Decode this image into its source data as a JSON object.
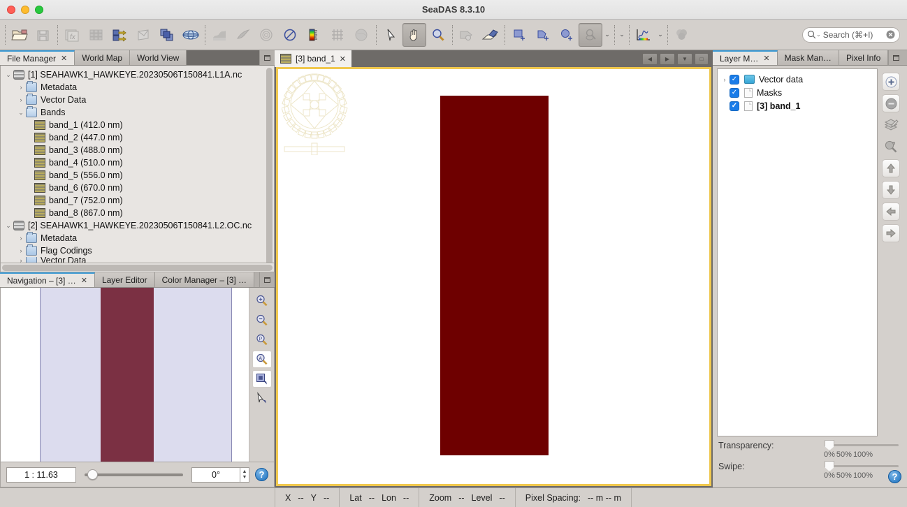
{
  "window": {
    "title": "SeaDAS 8.3.10",
    "controls": [
      "close",
      "minimize",
      "maximize"
    ]
  },
  "toolbar": {
    "groups": [
      {
        "items": [
          {
            "name": "open-product-icon",
            "label": "Open Product",
            "state": "enabled"
          },
          {
            "name": "save-product-icon",
            "label": "Save Product",
            "state": "disabled"
          }
        ]
      },
      {
        "items": [
          {
            "name": "band-maths-icon",
            "label": "Band Maths",
            "state": "disabled"
          },
          {
            "name": "grid-icon",
            "label": "Product Grid",
            "state": "disabled"
          },
          {
            "name": "reproject-icon",
            "label": "Reproject",
            "state": "enabled"
          },
          {
            "name": "subset-icon",
            "label": "Subset",
            "state": "disabled"
          },
          {
            "name": "collocate-icon",
            "label": "Collocation",
            "state": "enabled"
          },
          {
            "name": "globe-mesh-icon",
            "label": "Geo Coding",
            "state": "enabled"
          }
        ]
      },
      {
        "items": [
          {
            "name": "land-mask-icon",
            "label": "Land Water Mask",
            "state": "disabled"
          },
          {
            "name": "ocean-color-icon",
            "label": "Ocean Color",
            "state": "disabled"
          },
          {
            "name": "sst-icon",
            "label": "SST",
            "state": "disabled"
          },
          {
            "name": "no-data-icon",
            "label": "No Data Overlay",
            "state": "enabled"
          },
          {
            "name": "color-bar-icon",
            "label": "Colour Bar",
            "state": "enabled"
          },
          {
            "name": "graticule-icon",
            "label": "Graticule Overlay",
            "state": "disabled"
          },
          {
            "name": "world-map-overlay-icon",
            "label": "World Map Overlay",
            "state": "disabled"
          }
        ]
      },
      {
        "items": [
          {
            "name": "selection-arrow-icon",
            "label": "Selection Tool",
            "state": "enabled"
          },
          {
            "name": "pan-hand-icon",
            "label": "Panning Tool",
            "state": "selected"
          },
          {
            "name": "zoom-magnifier-icon",
            "label": "Zoom Tool",
            "state": "enabled"
          }
        ]
      },
      {
        "items": [
          {
            "name": "pin-placing-icon",
            "label": "Pin Placing Tool",
            "state": "disabled"
          },
          {
            "name": "gcp-placing-icon",
            "label": "GCP Placing Tool",
            "state": "enabled"
          }
        ]
      },
      {
        "items": [
          {
            "name": "rectangle-drawing-icon",
            "label": "Rectangle Drawing Tool",
            "state": "enabled"
          },
          {
            "name": "polygon-drawing-icon",
            "label": "Polygon Drawing Tool",
            "state": "enabled"
          },
          {
            "name": "ellipse-drawing-icon",
            "label": "Ellipse Drawing Tool",
            "state": "enabled"
          },
          {
            "name": "magic-wand-icon",
            "label": "Magic Wand",
            "state": "selected-disabled"
          }
        ]
      },
      {
        "items": [
          {
            "name": "colour-manipulation-icon",
            "label": "Colour Manipulation",
            "state": "enabled"
          }
        ]
      },
      {
        "items": [
          {
            "name": "rgb-image-icon",
            "label": "Open RGB Image View",
            "state": "disabled"
          }
        ]
      }
    ],
    "overflow_arrow": "⌄"
  },
  "search": {
    "icon": "search-icon",
    "placeholder": "Search (⌘+I)",
    "clear_icon": "clear-icon"
  },
  "left_panel": {
    "tabs": [
      {
        "label": "File Manager",
        "selected": true,
        "closable": true
      },
      {
        "label": "World Map",
        "selected": false,
        "closable": false
      },
      {
        "label": "World View",
        "selected": false,
        "closable": false
      }
    ],
    "minimize_label": "Minimize",
    "tree": [
      {
        "depth": 0,
        "twist": "⌄",
        "icon": "product-icon",
        "label": "[1] SEAHAWK1_HAWKEYE.20230506T150841.L1A.nc"
      },
      {
        "depth": 1,
        "twist": "›",
        "icon": "folder-icon",
        "label": "Metadata"
      },
      {
        "depth": 1,
        "twist": "›",
        "icon": "folder-icon",
        "label": "Vector Data"
      },
      {
        "depth": 1,
        "twist": "⌄",
        "icon": "folder-open-icon",
        "label": "Bands"
      },
      {
        "depth": 2,
        "twist": "",
        "icon": "band-icon",
        "label": "band_1 (412.0 nm)"
      },
      {
        "depth": 2,
        "twist": "",
        "icon": "band-icon",
        "label": "band_2 (447.0 nm)"
      },
      {
        "depth": 2,
        "twist": "",
        "icon": "band-icon",
        "label": "band_3 (488.0 nm)"
      },
      {
        "depth": 2,
        "twist": "",
        "icon": "band-icon",
        "label": "band_4 (510.0 nm)"
      },
      {
        "depth": 2,
        "twist": "",
        "icon": "band-icon",
        "label": "band_5 (556.0 nm)"
      },
      {
        "depth": 2,
        "twist": "",
        "icon": "band-icon",
        "label": "band_6 (670.0 nm)"
      },
      {
        "depth": 2,
        "twist": "",
        "icon": "band-icon",
        "label": "band_7 (752.0 nm)"
      },
      {
        "depth": 2,
        "twist": "",
        "icon": "band-icon",
        "label": "band_8 (867.0 nm)"
      },
      {
        "depth": 0,
        "twist": "⌄",
        "icon": "product-icon",
        "label": "[2] SEAHAWK1_HAWKEYE.20230506T150841.L2.OC.nc"
      },
      {
        "depth": 1,
        "twist": "›",
        "icon": "folder-icon",
        "label": "Metadata"
      },
      {
        "depth": 1,
        "twist": "›",
        "icon": "folder-icon",
        "label": "Flag Codings"
      },
      {
        "depth": 1,
        "twist": "›",
        "icon": "folder-icon",
        "label": "Vector Data"
      }
    ]
  },
  "nav_panel": {
    "tabs": [
      {
        "label": "Navigation – [3] …",
        "selected": true,
        "closable": true
      },
      {
        "label": "Layer Editor",
        "selected": false,
        "closable": false
      },
      {
        "label": "Color Manager – [3] …",
        "selected": false,
        "closable": false
      }
    ],
    "tools": [
      {
        "name": "zoom-in-icon",
        "label": "Zoom In",
        "active": false
      },
      {
        "name": "zoom-out-icon",
        "label": "Zoom Out",
        "active": false
      },
      {
        "name": "zoom-pixel-icon",
        "label": "Zoom to Pixel Resolution",
        "active": false
      },
      {
        "name": "zoom-all-icon",
        "label": "Zoom All",
        "active": true
      },
      {
        "name": "sync-views-icon",
        "label": "Synchronise Views",
        "active": true
      },
      {
        "name": "sync-cursor-icon",
        "label": "Synchronise Cursor",
        "active": false
      }
    ],
    "zoom_factor": "1 : 11.63",
    "rotation": "0°",
    "slider_value": 8,
    "help_label": "?"
  },
  "image_view": {
    "tabs": [
      {
        "icon": "band-icon",
        "label": "[3] band_1",
        "selected": true,
        "closable": true
      }
    ],
    "nav_buttons": [
      {
        "name": "scroll-left-button",
        "glyph": "◀"
      },
      {
        "name": "scroll-right-button",
        "glyph": "▶"
      },
      {
        "name": "tab-list-button",
        "glyph": "▼"
      },
      {
        "name": "maximize-view-button",
        "glyph": "□"
      }
    ],
    "overlay_icon": "pan-compass-icon",
    "image_color": "#6e0000",
    "background_color": "#ffffff",
    "focus_border_color": "#f0c84e"
  },
  "right_panel": {
    "tabs": [
      {
        "label": "Layer M…",
        "selected": true,
        "closable": true
      },
      {
        "label": "Mask Man…",
        "selected": false,
        "closable": false
      },
      {
        "label": "Pixel Info",
        "selected": false,
        "closable": false
      }
    ],
    "layers": [
      {
        "twist": "›",
        "checked": true,
        "icon": "vector-folder-icon",
        "label": "Vector data",
        "bold": false
      },
      {
        "twist": "",
        "checked": true,
        "icon": "layer-doc-icon",
        "label": "Masks",
        "bold": false
      },
      {
        "twist": "",
        "checked": true,
        "icon": "layer-doc-icon",
        "label": "[3] band_1",
        "bold": true
      }
    ],
    "tools": [
      {
        "name": "add-layer-icon",
        "label": "Add Layer",
        "glyph": "+"
      },
      {
        "name": "remove-layer-icon",
        "label": "Remove Layer",
        "glyph": "−"
      },
      {
        "name": "open-layer-editor-icon",
        "label": "Open Layer Editor",
        "glyph": ""
      },
      {
        "name": "zoom-to-layer-icon",
        "label": "Zoom to Layer",
        "glyph": ""
      },
      {
        "name": "move-layer-up-icon",
        "label": "Move Layer Up",
        "glyph": "↑"
      },
      {
        "name": "move-layer-down-icon",
        "label": "Move Layer Down",
        "glyph": "↓"
      },
      {
        "name": "move-layer-left-icon",
        "label": "Move Layer Left",
        "glyph": "←"
      },
      {
        "name": "move-layer-right-icon",
        "label": "Move Layer Right",
        "glyph": "→"
      }
    ],
    "transparency": {
      "label": "Transparency:",
      "ticks": [
        "0%",
        "50%",
        "100%"
      ],
      "value": 0
    },
    "swipe": {
      "label": "Swipe:",
      "ticks": [
        "0%",
        "50%",
        "100%"
      ],
      "value": 0
    },
    "help_label": "?"
  },
  "statusbar": {
    "position": {
      "x_label": "X",
      "x_value": "--",
      "y_label": "Y",
      "y_value": "--"
    },
    "geo": {
      "lat_label": "Lat",
      "lat_value": "--",
      "lon_label": "Lon",
      "lon_value": "--"
    },
    "zoom": {
      "zoom_label": "Zoom",
      "zoom_value": "--",
      "level_label": "Level",
      "level_value": "--"
    },
    "spacing": {
      "label": "Pixel Spacing:",
      "value": "-- m -- m"
    }
  }
}
